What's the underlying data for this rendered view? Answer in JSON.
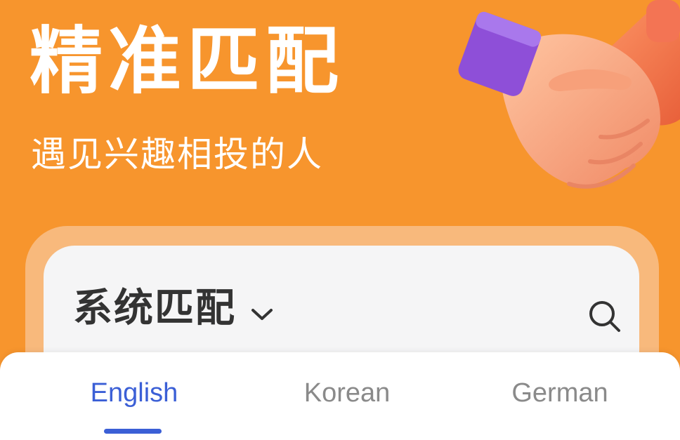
{
  "hero": {
    "title": "精准匹配",
    "subtitle": "遇见兴趣相投的人"
  },
  "match_card": {
    "selected_mode": "系统匹配",
    "dropdown_icon": "chevron-down-icon",
    "search_icon": "search-icon"
  },
  "language_tabs": {
    "active_index": 0,
    "items": [
      {
        "label": "English"
      },
      {
        "label": "Korean"
      },
      {
        "label": "German"
      }
    ]
  },
  "colors": {
    "background": "#F7952D",
    "card_border": "#F8B97C",
    "card": "#F5F5F6",
    "active_tab": "#3B5FD6",
    "inactive_tab": "#8A8A8A",
    "cuff": "#8E4FD8"
  }
}
